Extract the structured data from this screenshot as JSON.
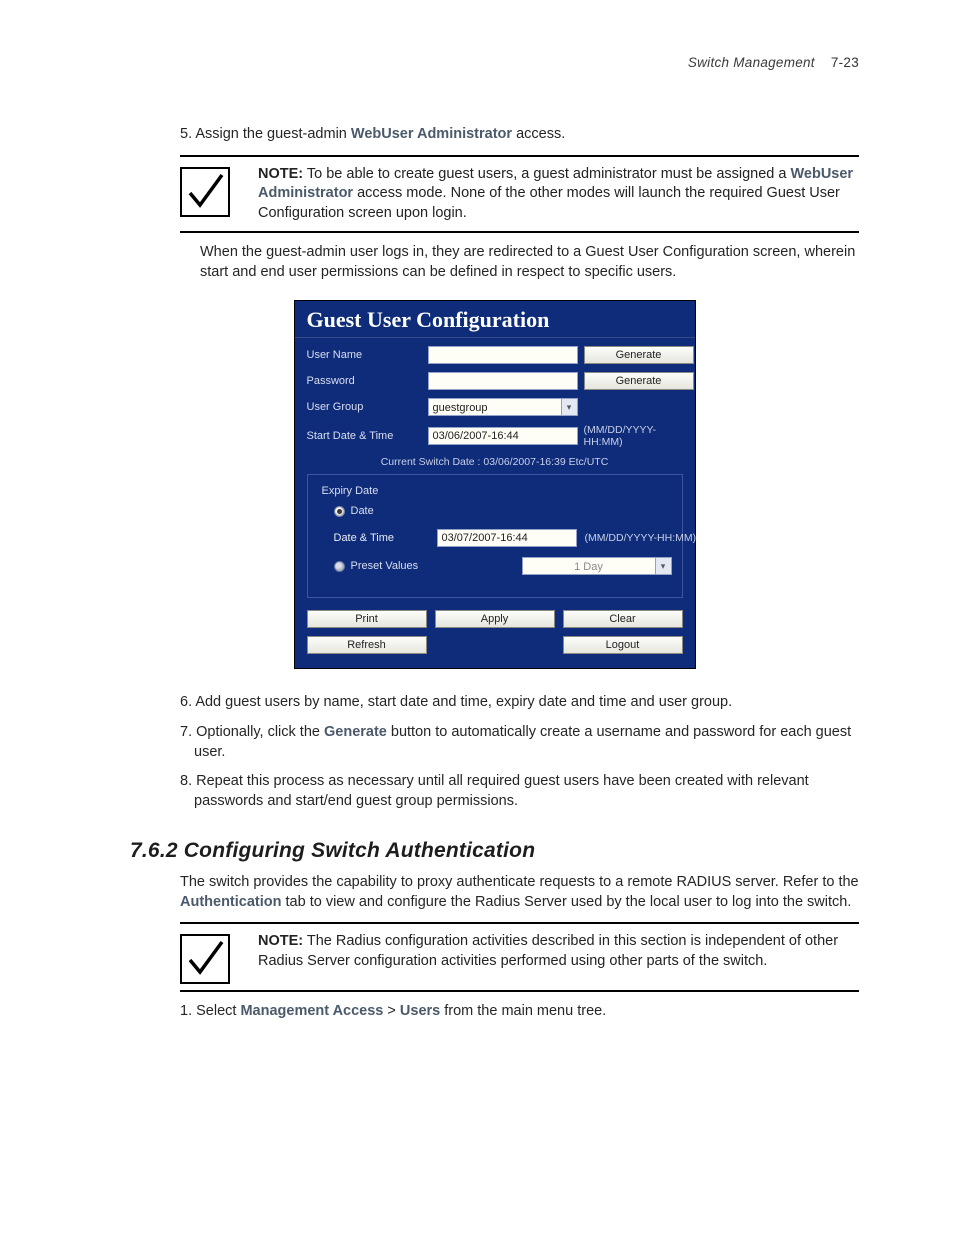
{
  "header": {
    "section": "Switch Management",
    "page": "7-23"
  },
  "steps": {
    "s5_pre": "5. Assign the guest-admin ",
    "s5_boldinline": "WebUser Administrator",
    "s5_post": " access.",
    "s6": "6. Add guest users by name, start date and time, expiry date and time and user group.",
    "s7_pre": "7. Optionally, click the ",
    "s7_bold": "Generate",
    "s7_post": " button to automatically create a username and password for each guest user.",
    "s8": "8. Repeat this process as necessary until all required guest users have been created with relevant passwords and start/end guest group permissions.",
    "sec2_1_pre": "1. Select ",
    "sec2_1_b1": "Management Access",
    "sec2_1_mid": " > ",
    "sec2_1_b2": "Users",
    "sec2_1_post": " from the main menu tree."
  },
  "note1": {
    "label": "NOTE:",
    "t1": " To be able to create guest users, a guest administrator must be assigned a ",
    "bold": "WebUser Administrator",
    "t2": " access mode. None of the other modes will launch the required Guest User Configuration screen upon login."
  },
  "body_after_note": "When the guest-admin user logs in, they are redirected to a Guest User Configuration screen, wherein start and end user permissions can be defined in respect to specific users.",
  "shot": {
    "title": "Guest User Configuration",
    "labels": {
      "username": "User Name",
      "password": "Password",
      "usergroup": "User Group",
      "start": "Start Date & Time",
      "hint_dt": "(MM/DD/YYYY-HH:MM)",
      "current": "Current Switch Date :  03/06/2007-16:39 Etc/UTC",
      "expiry": "Expiry Date",
      "date_radio": "Date",
      "datetime": "Date & Time",
      "preset": "Preset Values"
    },
    "values": {
      "username": "",
      "password": "",
      "usergroup": "guestgroup",
      "start": "03/06/2007-16:44",
      "datetime": "03/07/2007-16:44",
      "preset": "1 Day"
    },
    "buttons": {
      "generate": "Generate",
      "print": "Print",
      "apply": "Apply",
      "clear": "Clear",
      "refresh": "Refresh",
      "logout": "Logout"
    }
  },
  "sec2": {
    "heading": "7.6.2  Configuring Switch Authentication",
    "p_pre": "The switch provides the capability to proxy authenticate requests to a remote RADIUS server. Refer to the ",
    "p_bold": "Authentication",
    "p_post": " tab to view and configure the Radius Server used by the local user to log into the switch."
  },
  "note2": {
    "label": "NOTE:",
    "text": " The Radius configuration activities described in this section is independent of other Radius Server configuration activities performed using other parts of the switch."
  }
}
